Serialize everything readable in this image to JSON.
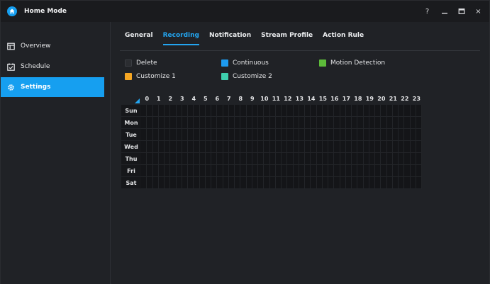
{
  "window": {
    "title": "Home Mode",
    "controls": [
      {
        "name": "help-button",
        "label": "?"
      },
      {
        "name": "minimize-button",
        "icon": "minimize-icon"
      },
      {
        "name": "maximize-button",
        "icon": "maximize-icon"
      },
      {
        "name": "close-button",
        "label": "×"
      }
    ]
  },
  "sidebar": {
    "items": [
      {
        "label": "Overview",
        "icon": "overview-icon",
        "active": false
      },
      {
        "label": "Schedule",
        "icon": "schedule-icon",
        "active": false
      },
      {
        "label": "Settings",
        "icon": "gear-icon",
        "active": true
      }
    ]
  },
  "tabs": [
    {
      "label": "General",
      "active": false
    },
    {
      "label": "Recording",
      "active": true
    },
    {
      "label": "Notification",
      "active": false
    },
    {
      "label": "Stream Profile",
      "active": false
    },
    {
      "label": "Action Rule",
      "active": false
    }
  ],
  "legend": [
    {
      "label": "Delete",
      "color": "#2b2d31"
    },
    {
      "label": "Continuous",
      "color": "#1d9bf0"
    },
    {
      "label": "Motion Detection",
      "color": "#5dbb3a"
    },
    {
      "label": "Customize 1",
      "color": "#f5a623"
    },
    {
      "label": "Customize 2",
      "color": "#3ecfae"
    }
  ],
  "schedule": {
    "hours": [
      "0",
      "1",
      "2",
      "3",
      "4",
      "5",
      "6",
      "7",
      "8",
      "9",
      "10",
      "11",
      "12",
      "13",
      "14",
      "15",
      "16",
      "17",
      "18",
      "19",
      "20",
      "21",
      "22",
      "23"
    ],
    "days": [
      "Sun",
      "Mon",
      "Tue",
      "Wed",
      "Thu",
      "Fri",
      "Sat"
    ]
  },
  "colors": {
    "accent": "#169ff0",
    "tab_active": "#23a5f0"
  }
}
